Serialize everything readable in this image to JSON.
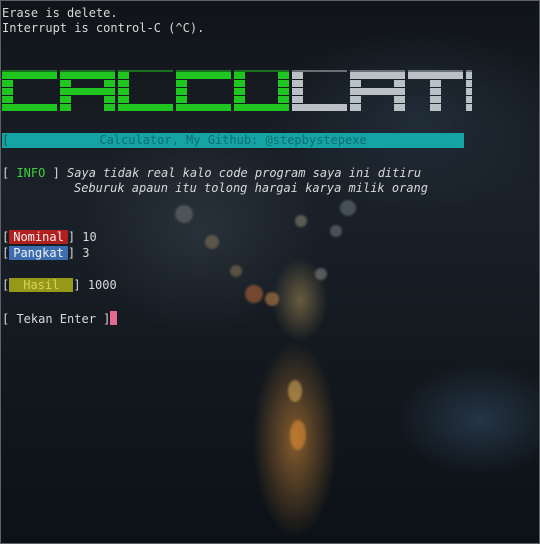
{
  "terminal": {
    "hint_line1": "Erase is delete.",
    "hint_line2": "Interrupt is control-C (^C).",
    "banner_part1": "CALCU",
    "banner_part2": "LATOR",
    "title_bracket": "[",
    "title_text": "Calculator, My Github: @stepbystepexe",
    "info_label": "INFO",
    "info_line1": "Saya tidak real kalo code program saya ini ditiru",
    "info_line2": "Seburuk apaun itu tolong hargai karya milik orang",
    "nominal_label": "Nominal",
    "nominal_value": "10",
    "pangkat_label": "Pangkat",
    "pangkat_value": "3",
    "hasil_label": "Hasil",
    "hasil_value": "1000",
    "prompt": "[ Tekan Enter ]"
  },
  "colors": {
    "banner_green": "#1fc61f",
    "banner_grey": "#b9c0c6",
    "title_bg": "#16a3a3"
  }
}
